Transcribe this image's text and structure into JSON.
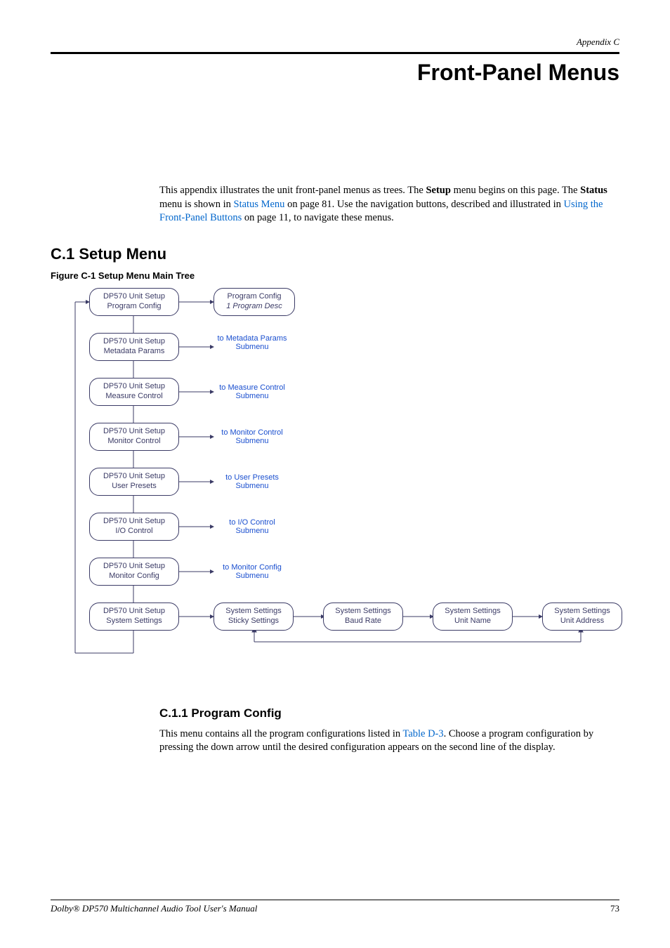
{
  "header": {
    "appendix": "Appendix C"
  },
  "title": "Front-Panel Menus",
  "intro": {
    "t1": "This appendix illustrates the unit front-panel menus as trees. The ",
    "t2": "Setup",
    "t3": " menu begins on this page. The ",
    "t4": "Status",
    "t5": " menu is shown in ",
    "link1": "Status Menu",
    "t6": " on page 81. Use the navigation buttons, described and illustrated in ",
    "link2": "Using the Front-Panel Buttons",
    "t7": " on page 11, to navigate these menus."
  },
  "setup": {
    "heading": "C.1   Setup Menu",
    "figcap": "Figure C-1   Setup Menu Main Tree"
  },
  "nodes": {
    "col1": [
      {
        "l1": "DP570  Unit Setup",
        "l2": "Program Config"
      },
      {
        "l1": "DP570  Unit Setup",
        "l2": "Metadata Params"
      },
      {
        "l1": "DP570 Unit Setup",
        "l2": "Measure Control"
      },
      {
        "l1": "DP570 Unit Setup",
        "l2": "Monitor Control"
      },
      {
        "l1": "DP570 Unit Setup",
        "l2": "User Presets"
      },
      {
        "l1": "DP570 Unit Setup",
        "l2": "I/O Control"
      },
      {
        "l1": "DP570 Unit Setup",
        "l2": "Monitor Config"
      },
      {
        "l1": "DP570  Unit Setup",
        "l2": "System Settings"
      }
    ],
    "progconf": {
      "l1": "Program Config",
      "l2": "1 Program Desc",
      "italic2": true
    },
    "subs": [
      "to Metadata Params Submenu",
      "to Measure Control Submenu",
      "to Monitor Control Submenu",
      "to User Presets Submenu",
      "to I/O Control Submenu",
      "to Monitor Config Submenu"
    ],
    "sysrow": [
      {
        "l1": "System Settings",
        "l2": "Sticky Settings"
      },
      {
        "l1": "System Settings",
        "l2": "Baud Rate"
      },
      {
        "l1": "System Settings",
        "l2": "Unit Name"
      },
      {
        "l1": "System Settings",
        "l2": "Unit Address"
      }
    ]
  },
  "progconf_section": {
    "heading": "C.1.1   Program Config",
    "t1": "This menu contains all the program configurations listed in ",
    "link": "Table D-3",
    "t2": ". Choose a program configuration by pressing the down arrow until the desired configuration appears on the second line of the display."
  },
  "footer": {
    "manual": "Dolby® DP570 Multichannel Audio Tool User's Manual",
    "page": "73"
  }
}
